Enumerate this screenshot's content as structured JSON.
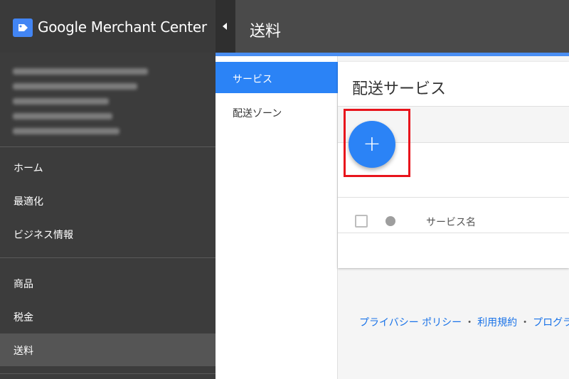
{
  "app": {
    "name": "Google Merchant Center",
    "logo_icon": "merchant-tag-icon",
    "collapse_icon": "chevron-left-icon"
  },
  "header": {
    "title": "送料"
  },
  "sidebar": {
    "account_lines": [
      "",
      "",
      "",
      "",
      ""
    ],
    "sections": [
      {
        "items": [
          {
            "label": "ホーム"
          },
          {
            "label": "最適化"
          },
          {
            "label": "ビジネス情報"
          }
        ]
      },
      {
        "items": [
          {
            "label": "商品"
          },
          {
            "label": "税金"
          },
          {
            "label": "送料",
            "active": true
          }
        ]
      }
    ]
  },
  "subnav": {
    "items": [
      {
        "label": "サービス",
        "active": true
      },
      {
        "label": "配送ゾーン"
      }
    ]
  },
  "main": {
    "title": "配送サービス",
    "fab": {
      "label": "+",
      "icon": "plus-icon"
    },
    "table": {
      "column_service_name": "サービス名"
    }
  },
  "footer": {
    "links": [
      "プライバシー ポリシー",
      "利用規約",
      "プログラ"
    ]
  },
  "colors": {
    "accent": "#2b83f6",
    "highlight": "#e8141c",
    "sidebar_bg": "#3c3c3c"
  }
}
